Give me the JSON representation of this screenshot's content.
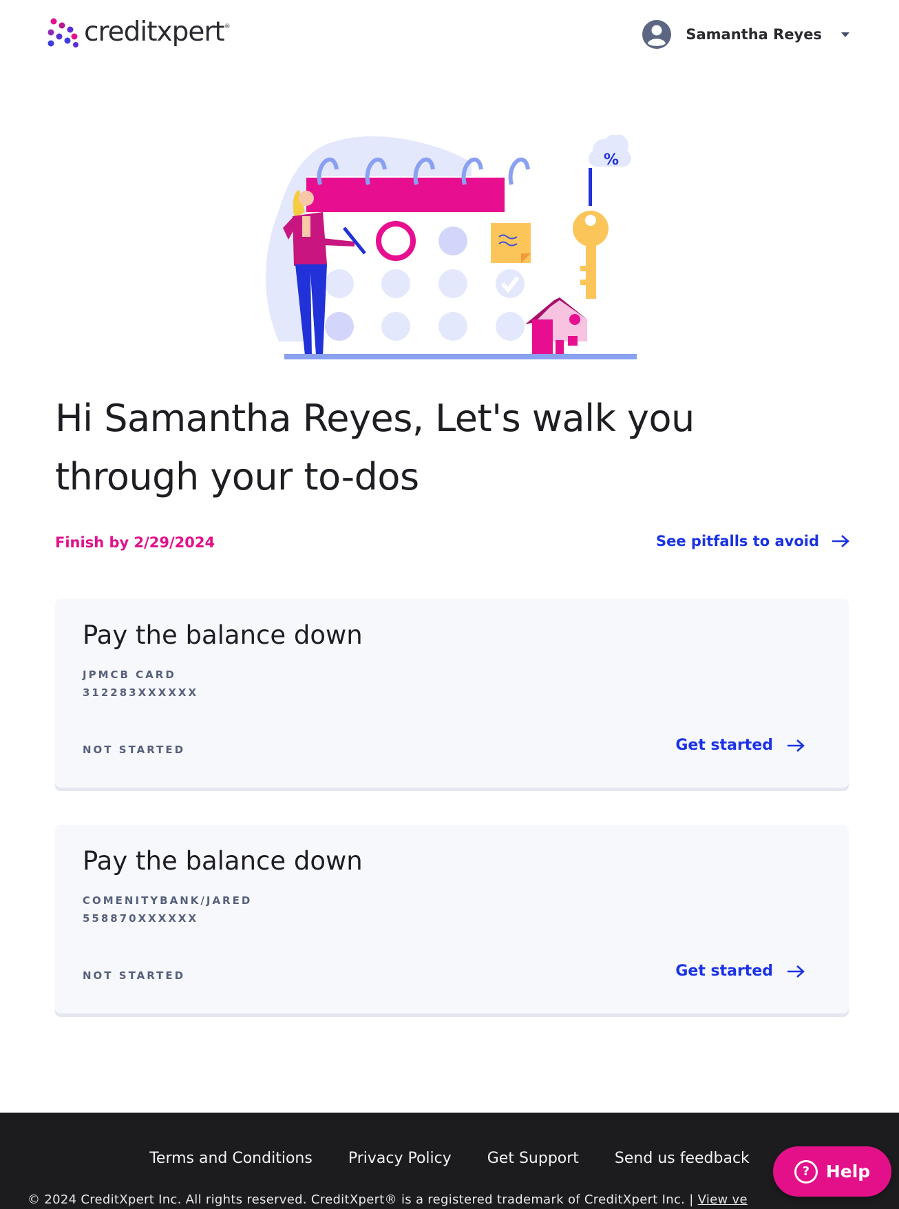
{
  "header": {
    "logo_text": "creditxpert",
    "logo_mark": "®",
    "user_name": "Samantha Reyes",
    "user_icon": "user-avatar-icon",
    "dropdown_icon": "caret-down-icon"
  },
  "hero": {
    "illustration_percent": "%"
  },
  "greeting": "Hi Samantha Reyes, Let's walk you through your to-dos",
  "finish_by": "Finish by 2/29/2024",
  "pitfalls_link": "See pitfalls to avoid",
  "tasks": [
    {
      "title": "Pay the balance down",
      "issuer": "JPMCB CARD",
      "account": "312283XXXXXX",
      "status": "NOT STARTED",
      "action": "Get started"
    },
    {
      "title": "Pay the balance down",
      "issuer": "COMENITYBANK/JARED",
      "account": "558870XXXXXX",
      "status": "NOT STARTED",
      "action": "Get started"
    }
  ],
  "footer": {
    "links": [
      "Terms and Conditions",
      "Privacy Policy",
      "Get Support",
      "Send us feedback"
    ],
    "copyright": "© 2024 CreditXpert Inc. All rights reserved. CreditXpert® is a registered trademark of CreditXpert Inc. | ",
    "version_link": "View ve"
  },
  "help_button": "Help",
  "colors": {
    "brand_pink": "#e3108a",
    "link_blue": "#1a32e6",
    "card_bg": "#f7f8fc",
    "footer_bg": "#1c1c1f"
  }
}
